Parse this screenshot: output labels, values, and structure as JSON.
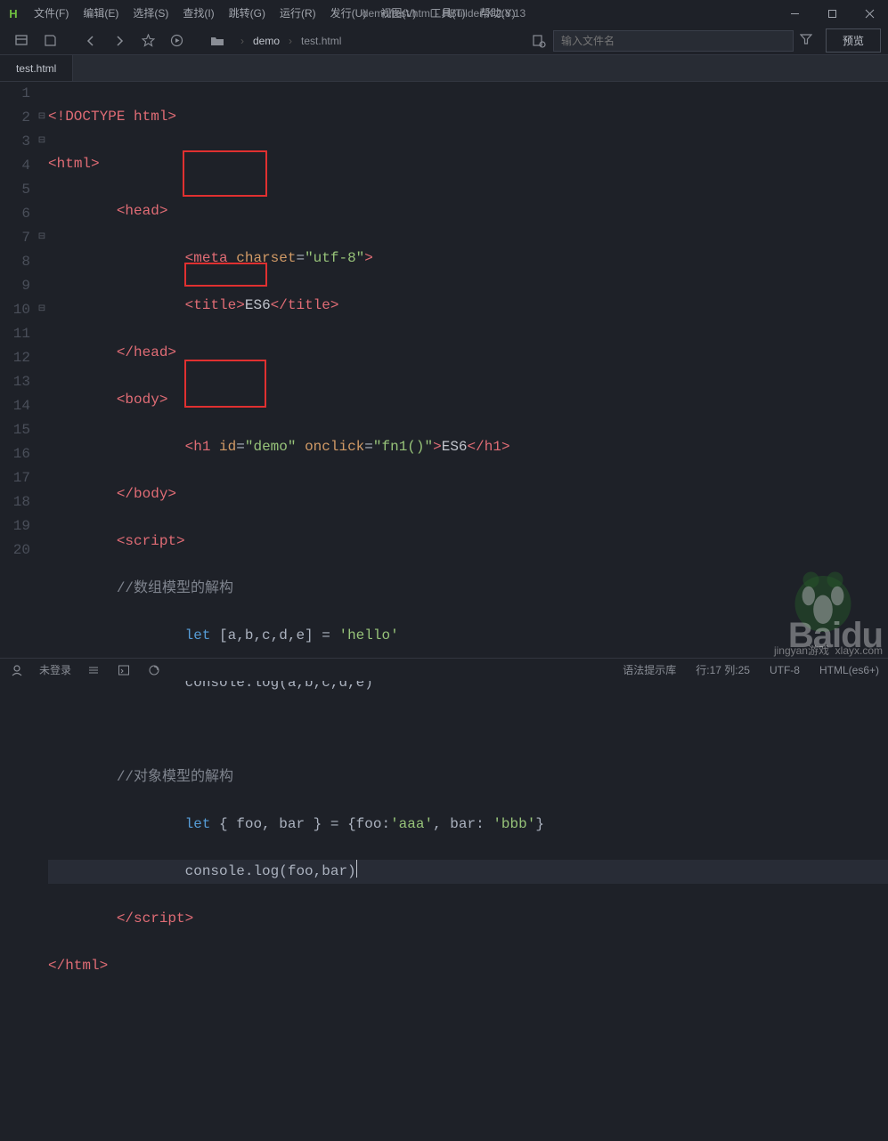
{
  "window": {
    "title": "demo/test.html - HBuilder X 2.8.13"
  },
  "menu": [
    "文件(F)",
    "编辑(E)",
    "选择(S)",
    "查找(I)",
    "跳转(G)",
    "运行(R)",
    "发行(U)",
    "视图(V)",
    "工具(T)",
    "帮助(Y)"
  ],
  "toolbar": {
    "breadcrumb": {
      "root": "demo",
      "file": "test.html"
    },
    "search_placeholder": "输入文件名",
    "preview_label": "预览"
  },
  "tab": {
    "label": "test.html"
  },
  "code": {
    "l1_a": "<!DOCTYPE html>",
    "l2_a": "<",
    "l2_b": "html",
    "l2_c": ">",
    "l3_a": "<",
    "l3_b": "head",
    "l3_c": ">",
    "l4_a": "<",
    "l4_b": "meta",
    "l4_c": " charset",
    "l4_d": "=",
    "l4_e": "\"utf-8\"",
    "l4_f": ">",
    "l5_a": "<",
    "l5_b": "title",
    "l5_c": ">",
    "l5_d": "ES6",
    "l5_e": "</",
    "l5_f": "title",
    "l5_g": ">",
    "l6_a": "</",
    "l6_b": "head",
    "l6_c": ">",
    "l7_a": "<",
    "l7_b": "body",
    "l7_c": ">",
    "l8_a": "<",
    "l8_b": "h1",
    "l8_c": " id",
    "l8_d": "=",
    "l8_e": "\"demo\"",
    "l8_f": " onclick",
    "l8_g": "=",
    "l8_h": "\"fn1()\"",
    "l8_i": ">",
    "l8_j": "ES6",
    "l8_k": "</",
    "l8_l": "h1",
    "l8_m": ">",
    "l9_a": "</",
    "l9_b": "body",
    "l9_c": ">",
    "l10_a": "<",
    "l10_b": "script",
    "l10_c": ">",
    "l11": "//数组模型的解构",
    "l12_a": "let",
    "l12_b": " [a,b,c,d,e] = ",
    "l12_c": "'hello'",
    "l13": "console.log(a,b,c,d,e)",
    "l15": "//对象模型的解构",
    "l16_a": "let",
    "l16_b": " { foo, bar } = {foo:",
    "l16_c": "'aaa'",
    "l16_d": ", bar: ",
    "l16_e": "'bbb'",
    "l16_f": "}",
    "l17": "console.log(foo,bar)",
    "l18_a": "</",
    "l18_b": "script",
    "l18_c": ">",
    "l19_a": "</",
    "l19_b": "html",
    "l19_c": ">"
  },
  "status": {
    "login": "未登录",
    "hint": "语法提示库",
    "pos": "行:17  列:25",
    "enc": "UTF-8",
    "lang": "HTML(es6+)"
  },
  "lines": [
    "1",
    "2",
    "3",
    "4",
    "5",
    "6",
    "7",
    "8",
    "9",
    "10",
    "11",
    "12",
    "13",
    "14",
    "15",
    "16",
    "17",
    "18",
    "19",
    "20"
  ],
  "watermark": {
    "brand": "Baidu",
    "url": "xlayx.com",
    "sub": "jingyan游戏"
  }
}
